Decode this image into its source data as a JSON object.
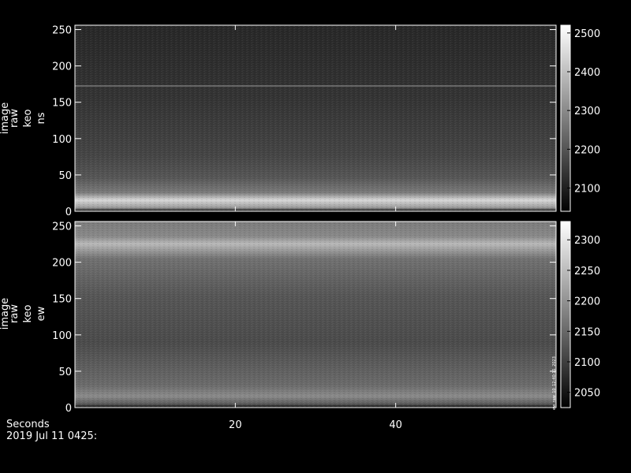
{
  "chart_data": [
    {
      "type": "heatmap",
      "ylabel_lines": [
        "image",
        "raw",
        "keo",
        "ns"
      ],
      "x_ticks": [
        20,
        40
      ],
      "xlim": [
        0,
        60
      ],
      "y_ticks": [
        0,
        50,
        100,
        150,
        200,
        250
      ],
      "ylim": [
        0,
        256
      ],
      "colorbar_ticks": [
        2100,
        2200,
        2300,
        2400,
        2500
      ],
      "colorbar_range": [
        2040,
        2520
      ],
      "colormap": "grayscale",
      "profile_note_values": {
        "bright_band_y": 12,
        "faint_line_y": 174
      }
    },
    {
      "type": "heatmap",
      "ylabel_lines": [
        "image",
        "raw",
        "keo",
        "ew"
      ],
      "x_ticks": [
        20,
        40
      ],
      "xlim": [
        0,
        60
      ],
      "y_ticks": [
        0,
        50,
        100,
        150,
        200,
        250
      ],
      "ylim": [
        0,
        256
      ],
      "colorbar_ticks": [
        2050,
        2100,
        2150,
        2200,
        2250,
        2300
      ],
      "colorbar_range": [
        2025,
        2330
      ],
      "colormap": "grayscale",
      "profile_note_values": {
        "bright_band_y": 228,
        "low_band_y": 20
      }
    }
  ],
  "footer": {
    "xlabel": "Seconds",
    "date": "2019 Jul 11 0425:"
  },
  "stamp_text": "ew_raw_10_12:40:11_2023"
}
